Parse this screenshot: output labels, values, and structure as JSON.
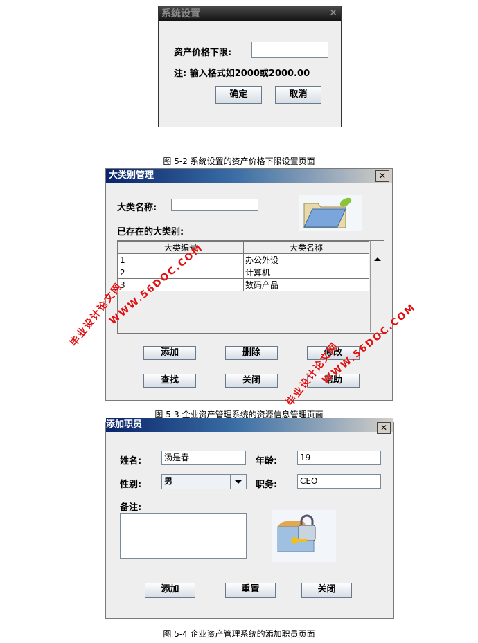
{
  "dialog1": {
    "title": "系统设置",
    "label": "资产价格下限:",
    "value": "",
    "note": "注: 输入格式如2000或2000.00",
    "ok": "确定",
    "cancel": "取消",
    "close": "✕"
  },
  "caption1": "图 5-2  系统设置的资产价格下限设置页面",
  "dialog2": {
    "title": "大类别管理",
    "name_label": "大类名称:",
    "name_value": "",
    "existing_label": "已存在的大类别:",
    "columns": [
      "大类编号",
      "大类名称"
    ],
    "rows": [
      [
        "1",
        "办公外设"
      ],
      [
        "2",
        "计算机"
      ],
      [
        "3",
        "数码产品"
      ]
    ],
    "buttons": [
      "添加",
      "删除",
      "修改",
      "查找",
      "关闭",
      "帮助"
    ],
    "close": "✕",
    "icon": "folder-icon"
  },
  "caption2": "图 5-3  企业资产管理系统的资源信息管理页面",
  "dialog3": {
    "title": "添加职员",
    "name_label": "姓名:",
    "name_value": "汤是春",
    "age_label": "年龄:",
    "age_value": "19",
    "gender_label": "性别:",
    "gender_value": "男",
    "position_label": "职务:",
    "position_value": "CEO",
    "remark_label": "备注:",
    "remark_value": "",
    "buttons": [
      "添加",
      "重置",
      "关闭"
    ],
    "close": "✕",
    "icon": "lock-folder-icon"
  },
  "caption3": "图 5-4  企业资产管理系统的添加职员页面",
  "watermark": {
    "cn": "毕业设计论文网",
    "url": "WWW.56DOC.COM",
    "color": "#e01010"
  }
}
